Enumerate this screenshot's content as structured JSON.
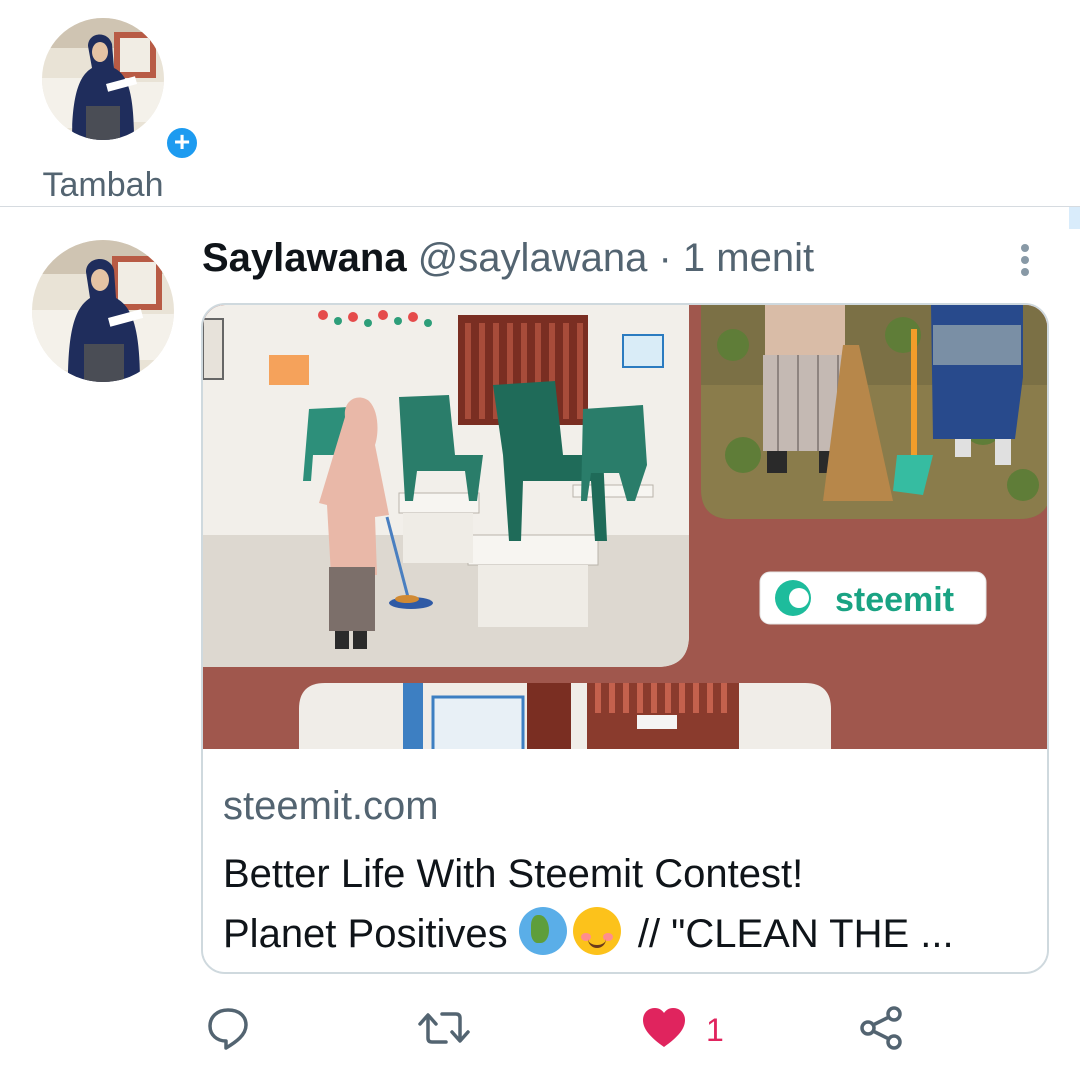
{
  "fleets": {
    "add_label": "Tambah",
    "plus_symbol": "+"
  },
  "tweet": {
    "display_name": "Saylawana",
    "handle": "@saylawana",
    "separator": "·",
    "time": "1 menit",
    "card": {
      "image_badge_text": "steemit",
      "domain": "steemit.com",
      "title_line1": "Better Life With Steemit Contest!",
      "title_line2_text": "Planet Positives",
      "title_line2_rest": " // \"CLEAN THE ...",
      "title_emojis": [
        "globe-emoji",
        "smiling-face-emoji"
      ]
    },
    "actions": {
      "reply_icon": "reply-icon",
      "retweet_icon": "retweet-icon",
      "like_icon": "heart-icon",
      "like_count": "1",
      "share_icon": "share-icon",
      "liked": true
    }
  },
  "colors": {
    "accent": "#1d9bf0",
    "like": "#e0245e",
    "secondary_text": "#536471",
    "border": "#cfd9de",
    "card_background": "#a0574d"
  }
}
